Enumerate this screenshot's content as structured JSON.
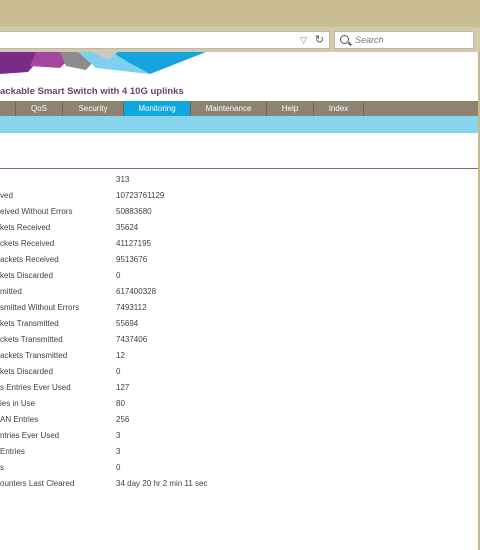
{
  "browser": {
    "search_placeholder": "Search"
  },
  "header": {
    "product_title": "ackable Smart Switch with 4 10G uplinks"
  },
  "menu": {
    "tabs": [
      {
        "label": ""
      },
      {
        "label": "QoS"
      },
      {
        "label": "Security"
      },
      {
        "label": "Monitoring"
      },
      {
        "label": "Maintenance"
      },
      {
        "label": "Help"
      },
      {
        "label": "Index"
      }
    ],
    "active": "Monitoring"
  },
  "stats": {
    "rows": [
      {
        "label": "",
        "value": "313"
      },
      {
        "label": "ved",
        "value": "10723761129"
      },
      {
        "label": "eived Without Errors",
        "value": "50883680"
      },
      {
        "label": "kets Received",
        "value": "35624"
      },
      {
        "label": "ckets Received",
        "value": "41127195"
      },
      {
        "label": "ackets Received",
        "value": "9513676"
      },
      {
        "label": "kets Discarded",
        "value": "0"
      },
      {
        "label": "mitted",
        "value": "617400328"
      },
      {
        "label": "smitted Without Errors",
        "value": "7493112"
      },
      {
        "label": "kets Transmitted",
        "value": "55694"
      },
      {
        "label": "ckets Transmitted",
        "value": "7437406"
      },
      {
        "label": "ackets Transmitted",
        "value": "12"
      },
      {
        "label": "kets Discarded",
        "value": "0"
      },
      {
        "label": "s Entries Ever Used",
        "value": "127"
      },
      {
        "label": "ies in Use",
        "value": "80"
      },
      {
        "label": "AN Entries",
        "value": "256"
      },
      {
        "label": "ntries Ever Used",
        "value": "3"
      },
      {
        "label": "Entries",
        "value": "3"
      },
      {
        "label": "s",
        "value": "0"
      },
      {
        "label": "ounters Last Cleared",
        "value": "34 day 20 hr 2 min 11 sec"
      }
    ]
  },
  "colors": {
    "accent": "#0ea7e0",
    "menu_bg": "#8c8370",
    "title": "#6d3d77",
    "subbar": "#87d4ef"
  }
}
